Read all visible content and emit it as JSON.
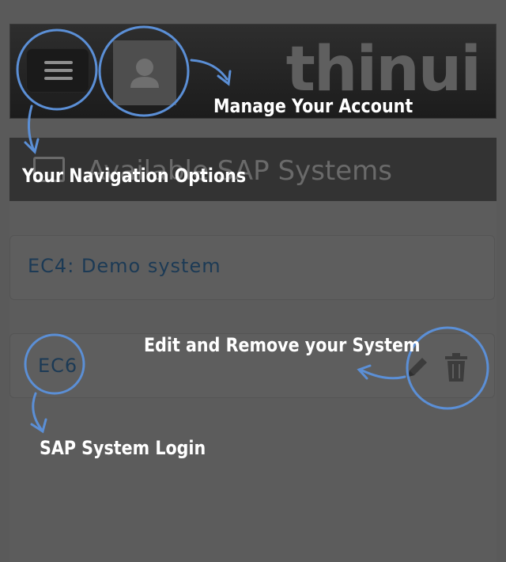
{
  "header": {
    "brand": "thinui",
    "menu_icon": "hamburger-icon",
    "avatar_icon": "user-icon"
  },
  "section": {
    "title": "Available SAP Systems",
    "icon": "list-icon"
  },
  "systems": [
    {
      "label": "EC4: Demo system"
    },
    {
      "label": "EC6",
      "actions": [
        "pencil-icon",
        "trash-icon"
      ]
    }
  ],
  "annotations": {
    "manage_account": "Manage Your Account",
    "navigation": "Your Navigation Options",
    "edit_remove": "Edit and Remove your System",
    "login": "SAP System Login"
  },
  "colors": {
    "annotation_ring": "#5b8fd6",
    "annotation_text": "#ffffff",
    "system_label": "#1c3a55"
  }
}
